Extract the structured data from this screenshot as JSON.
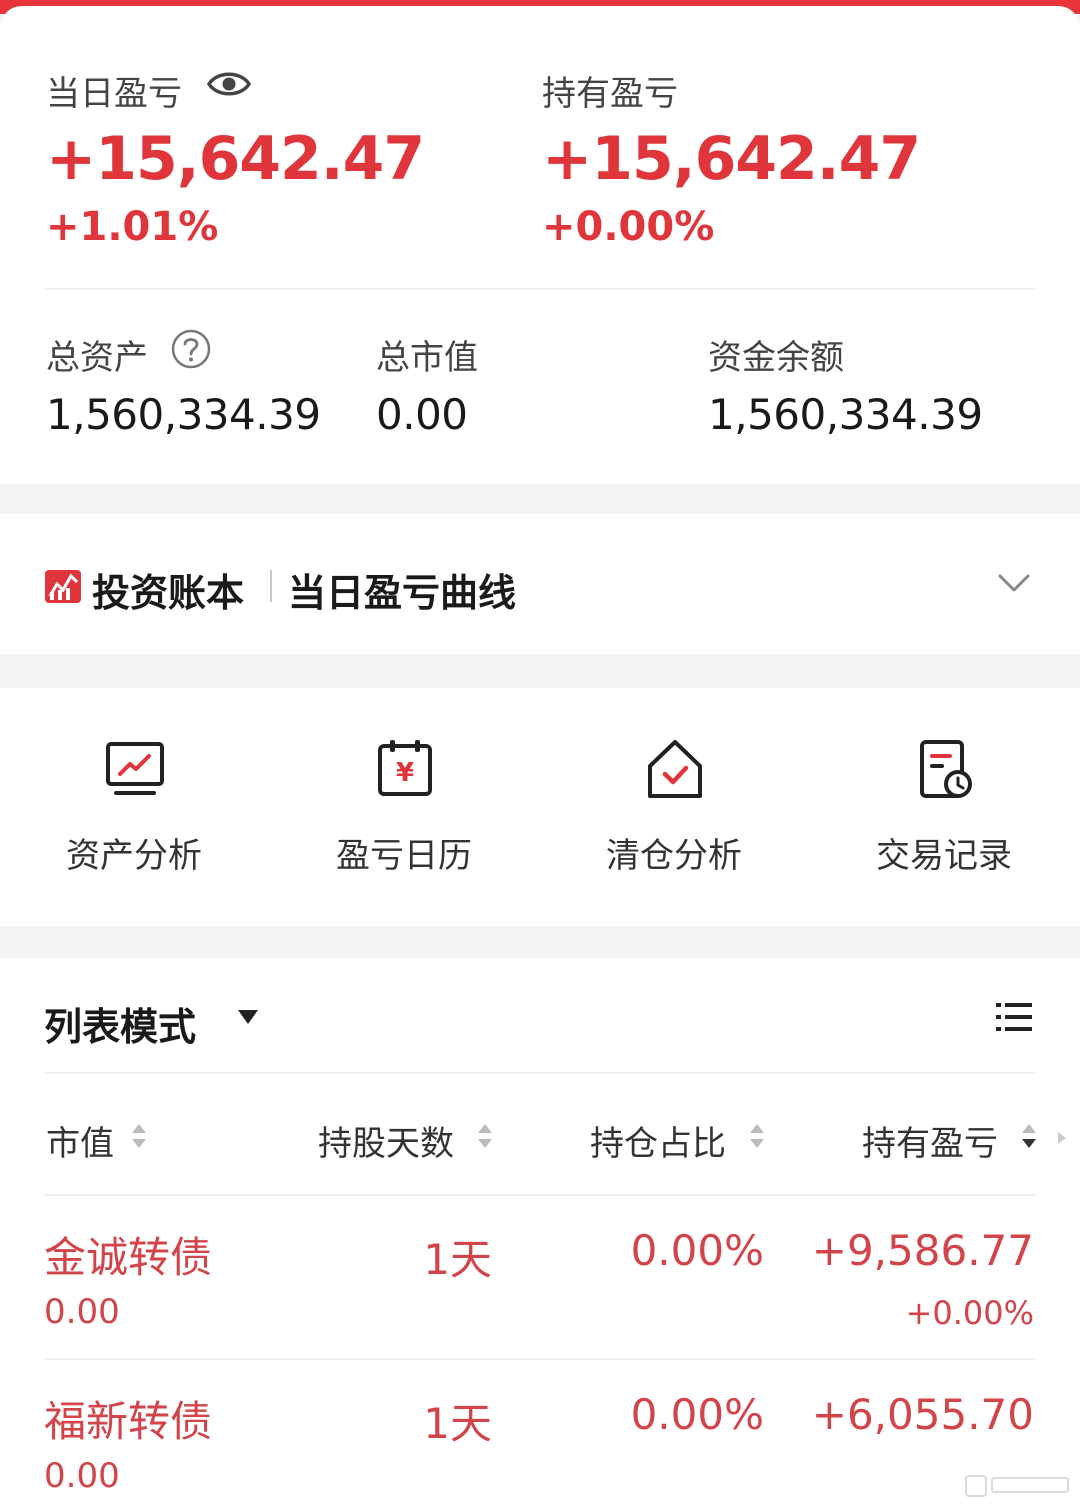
{
  "summary": {
    "daily_pnl_label": "当日盈亏",
    "daily_pnl_value": "+15,642.47",
    "daily_pnl_pct": "+1.01%",
    "holding_pnl_label": "持有盈亏",
    "holding_pnl_value": "+15,642.47",
    "holding_pnl_pct": "+0.00%"
  },
  "assets": {
    "total_label": "总资产",
    "total_value": "1,560,334.39",
    "market_label": "总市值",
    "market_value": "0.00",
    "cash_label": "资金余额",
    "cash_value": "1,560,334.39"
  },
  "ledger": {
    "brand": "投资账本",
    "subtitle": "当日盈亏曲线"
  },
  "tools": [
    {
      "label": "资产分析",
      "icon": "chart-monitor-icon"
    },
    {
      "label": "盈亏日历",
      "icon": "yuan-calendar-icon"
    },
    {
      "label": "清仓分析",
      "icon": "house-check-icon"
    },
    {
      "label": "交易记录",
      "icon": "document-clock-icon"
    }
  ],
  "list": {
    "mode_label": "列表模式",
    "columns": [
      "市值",
      "持股天数",
      "持仓占比",
      "持有盈亏"
    ],
    "rows": [
      {
        "name": "金诚转债",
        "market_value": "0.00",
        "days": "1天",
        "ratio": "0.00%",
        "pnl": "+9,586.77",
        "pnl_pct": "+0.00%"
      },
      {
        "name": "福新转债",
        "market_value": "0.00",
        "days": "1天",
        "ratio": "0.00%",
        "pnl": "+6,055.70",
        "pnl_pct": ""
      }
    ]
  },
  "colors": {
    "accent_red": "#e0353b",
    "row_red": "#d2444a"
  }
}
